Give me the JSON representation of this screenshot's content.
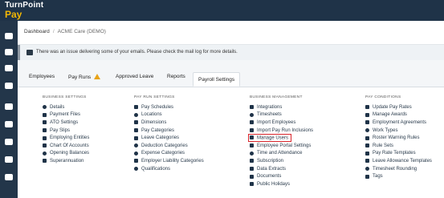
{
  "app": {
    "logo_name": "TurnPoint",
    "logo_sub": "Pay"
  },
  "breadcrumb": {
    "root": "Dashboard",
    "current": "ACME Care (DEMO)"
  },
  "alert": {
    "text": "There was an issue delivering some of your emails. Please check the mail log for more details."
  },
  "tabs": [
    {
      "label": "Employees"
    },
    {
      "label": "Pay Runs"
    },
    {
      "label": "Approved Leave"
    },
    {
      "label": "Reports"
    },
    {
      "label": "Payroll Settings"
    }
  ],
  "columns": [
    {
      "heading": "BUSINESS SETTINGS",
      "items": [
        "Details",
        "Payment Files",
        "ATO Settings",
        "Pay Slips",
        "Employing Entities",
        "Chart Of Accounts",
        "Opening Balances",
        "Superannuation"
      ]
    },
    {
      "heading": "PAY RUN SETTINGS",
      "items": [
        "Pay Schedules",
        "Locations",
        "Dimensions",
        "Pay Categories",
        "Leave Categories",
        "Deduction Categories",
        "Expense Categories",
        "Employer Liability Categories",
        "Qualifications"
      ]
    },
    {
      "heading": "BUSINESS MANAGEMENT",
      "items": [
        "Integrations",
        "Timesheets",
        "Import Employees",
        "Import Pay Run Inclusions",
        "Manage Users",
        "Employee Portal Settings",
        "Time and Attendance",
        "Subscription",
        "Data Extracts",
        "Documents",
        "Public Holidays"
      ]
    },
    {
      "heading": "PAY CONDITIONS",
      "items": [
        "Update Pay Rates",
        "Manage Awards",
        "Employment Agreements",
        "Work Types",
        "Roster Warning Rules",
        "Rule Sets",
        "Pay Rate Templates",
        "Leave Allowance Templates",
        "Timesheet Rounding",
        "Tags"
      ]
    }
  ],
  "colors": {
    "nav": "#1f3348",
    "accent": "#f2b705",
    "highlight": "#d9262c",
    "warning": "#e8a317"
  }
}
